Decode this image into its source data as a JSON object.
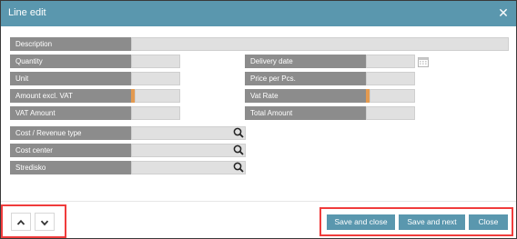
{
  "dialog": {
    "title": "Line edit",
    "close_icon": "close-icon"
  },
  "fields": {
    "description": {
      "label": "Description",
      "value": ""
    },
    "quantity": {
      "label": "Quantity",
      "value": ""
    },
    "delivery_date": {
      "label": "Delivery date",
      "value": ""
    },
    "unit": {
      "label": "Unit",
      "value": ""
    },
    "price_per_pcs": {
      "label": "Price per Pcs.",
      "value": ""
    },
    "amount_excl_vat": {
      "label": "Amount excl. VAT",
      "value": ""
    },
    "vat_rate": {
      "label": "Vat Rate",
      "value": ""
    },
    "vat_amount": {
      "label": "VAT Amount",
      "value": ""
    },
    "total_amount": {
      "label": "Total Amount",
      "value": ""
    },
    "cost_revenue_type": {
      "label": "Cost / Revenue type",
      "value": ""
    },
    "cost_center": {
      "label": "Cost center",
      "value": ""
    },
    "stredisko": {
      "label": "Stredisko",
      "value": ""
    }
  },
  "footer": {
    "save_and_close": "Save and close",
    "save_and_next": "Save and next",
    "close": "Close"
  },
  "colors": {
    "titlebar": "#5a97ae",
    "label_bg": "#8c8c8c",
    "value_bg": "#e0e0e0",
    "accent": "#e39a50",
    "highlight_border": "#f03c3c"
  }
}
